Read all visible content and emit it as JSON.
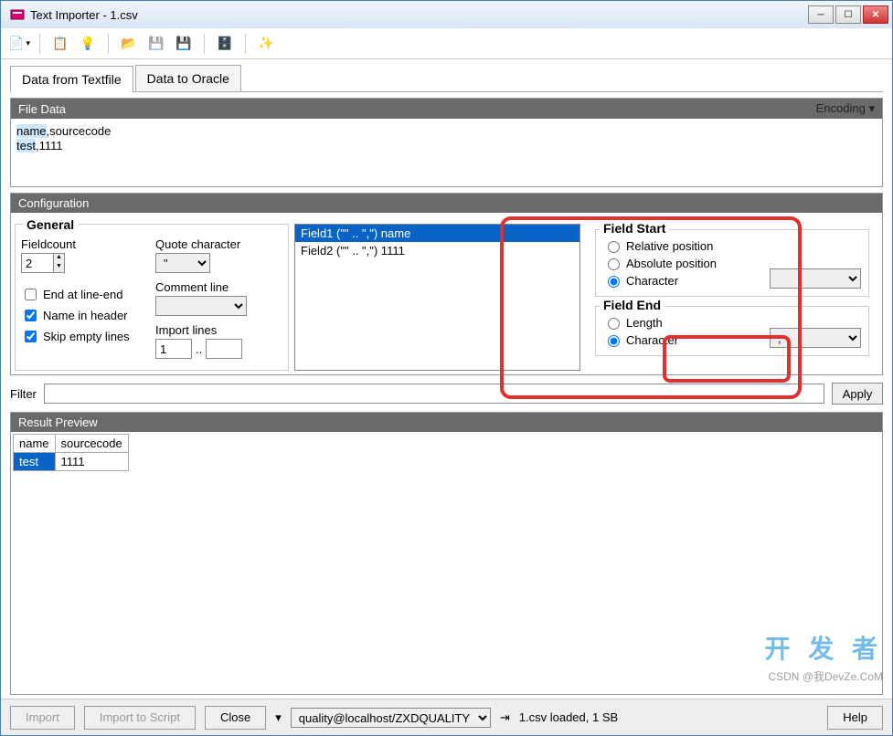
{
  "window": {
    "title": "Text Importer - 1.csv"
  },
  "tabs": {
    "t1": "Data from Textfile",
    "t2": "Data to Oracle"
  },
  "fileData": {
    "header": "File Data",
    "encoding_label": "Encoding",
    "line1a": "name",
    "line1b": ",sourcecode",
    "line2a": "test",
    "line2b": ",1111"
  },
  "config": {
    "header": "Configuration",
    "general": {
      "title": "General",
      "fieldcount_label": "Fieldcount",
      "fieldcount_value": "2",
      "end_at_line_end": "End at line-end",
      "name_in_header": "Name in header",
      "skip_empty": "Skip empty lines",
      "quote_label": "Quote character",
      "quote_value": "\"",
      "comment_label": "Comment line",
      "comment_value": "",
      "import_label": "Import lines",
      "import_from": "1",
      "import_dots": "..",
      "import_to": ""
    },
    "fields": [
      {
        "label": "Field1  (\"\" .. \",\")  name"
      },
      {
        "label": "Field2  (\"\" .. \",\")  1111"
      }
    ],
    "fieldStart": {
      "title": "Field Start",
      "r1": "Relative position",
      "r2": "Absolute position",
      "r3": "Character",
      "value": ""
    },
    "fieldEnd": {
      "title": "Field End",
      "r1": "Length",
      "r2": "Character",
      "value": ","
    }
  },
  "filter": {
    "label": "Filter",
    "value": "",
    "apply": "Apply"
  },
  "result": {
    "header": "Result Preview",
    "cols": [
      "name",
      "sourcecode"
    ],
    "rows": [
      [
        "test",
        "1111"
      ]
    ]
  },
  "footer": {
    "import_btn": "Import",
    "import_script_btn": "Import to Script",
    "close_btn": "Close",
    "conn": "quality@localhost/ZXDQUALITY",
    "status": "1.csv loaded, 1 SB",
    "help": "Help"
  },
  "watermark": {
    "big": "开 发 者",
    "small": "CSDN @我DevZe.CoM"
  }
}
